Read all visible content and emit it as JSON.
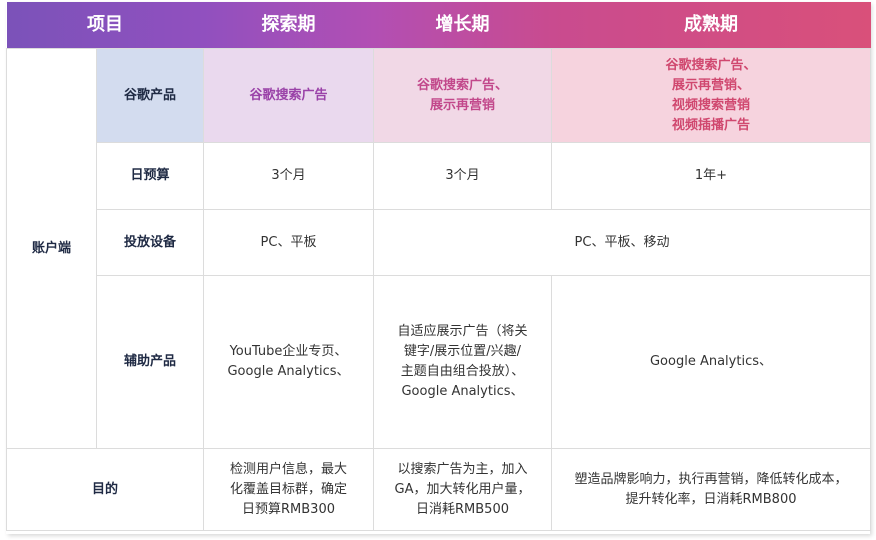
{
  "header": {
    "item": "项目",
    "explore": "探索期",
    "growth": "增长期",
    "mature": "成熟期"
  },
  "side": {
    "account": "账户端"
  },
  "rows": {
    "google_products": {
      "label": "谷歌产品",
      "explore": "谷歌搜索广告",
      "growth": "谷歌搜索广告、\n展示再营销",
      "mature": "谷歌搜索广告、\n展示再营销、\n视频搜索营销\n视频插播广告"
    },
    "daily_budget": {
      "label": "日预算",
      "explore": "3个月",
      "growth": "3个月",
      "mature": "1年+"
    },
    "devices": {
      "label": "投放设备",
      "explore": "PC、平板",
      "growth_mature": "PC、平板、移动"
    },
    "assist_products": {
      "label": "辅助产品",
      "explore": "YouTube企业专页、\nGoogle Analytics、",
      "growth": "自适应展示广告（将关\n键字/展示位置/兴趣/\n主题自由组合投放）、\nGoogle Analytics、",
      "mature": "Google Analytics、"
    },
    "goal": {
      "label": "目的",
      "explore": "检测用户信息，最大\n化覆盖目标群，确定\n日预算RMB300",
      "growth": "以搜索广告为主，加入\nGA，加大转化用户量，\n日消耗RMB500",
      "mature": "塑造品牌影响力，执行再营销，降低转化成本，\n提升转化率，日消耗RMB800"
    }
  },
  "colors": {
    "explore_accent": "#9a42a8",
    "growth_accent": "#c2488b",
    "mature_accent": "#d0486f",
    "label_navy": "#1f2a44"
  }
}
